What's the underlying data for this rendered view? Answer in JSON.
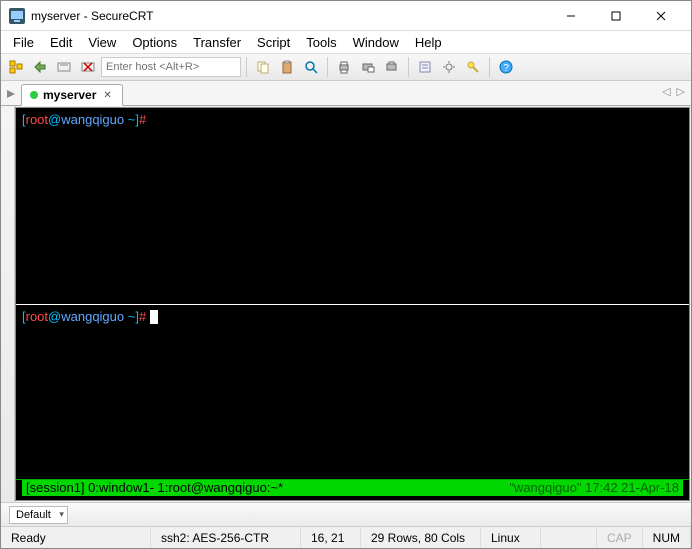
{
  "window": {
    "title": "myserver - SecureCRT"
  },
  "menu": {
    "file": "File",
    "edit": "Edit",
    "view": "View",
    "options": "Options",
    "transfer": "Transfer",
    "script": "Script",
    "tools": "Tools",
    "window": "Window",
    "help": "Help"
  },
  "toolbar": {
    "host_placeholder": "Enter host <Alt+R>"
  },
  "tab": {
    "name": "myserver"
  },
  "terminal": {
    "prompt_open": "[",
    "prompt_user": "root",
    "prompt_at": "@",
    "prompt_host": "wangqiguo",
    "prompt_tail": " ~]",
    "hash": "#",
    "tmux_left": "[session1] 0:window1- 1:root@wangqiguo:~*",
    "tmux_right": "\"wangqiguo\" 17:42 21-Apr-18"
  },
  "session_dd": {
    "label": "Default"
  },
  "status": {
    "ready": "Ready",
    "cipher": "ssh2: AES-256-CTR",
    "pos": "16, 21",
    "size": "29 Rows, 80 Cols",
    "os": "Linux",
    "cap": "CAP",
    "num": "NUM"
  }
}
